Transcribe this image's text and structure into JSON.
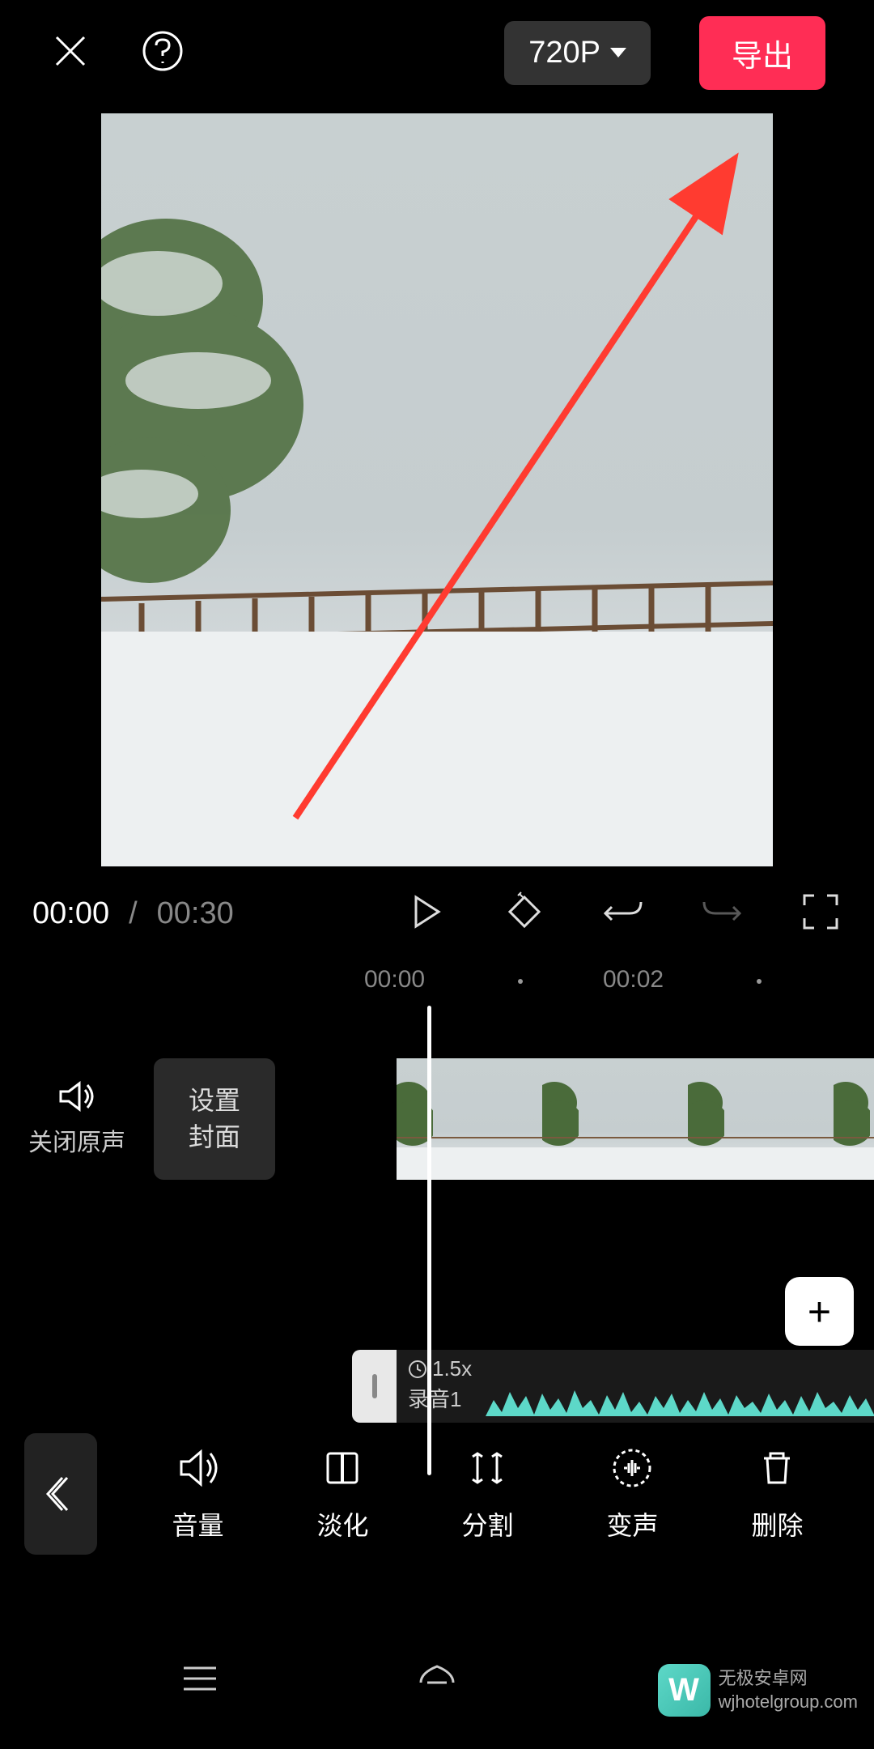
{
  "header": {
    "resolution": "720P",
    "export_label": "导出"
  },
  "playback": {
    "current_time": "00:00",
    "separator": "/",
    "total_time": "00:30"
  },
  "timeline": {
    "ruler_times": [
      "00:00",
      "00:02"
    ],
    "mute_label": "关闭原声",
    "cover_label_line1": "设置",
    "cover_label_line2": "封面",
    "add_label": "+",
    "audio_speed": "1.5x",
    "audio_name": "录音1"
  },
  "tools": [
    {
      "id": "volume",
      "label": "音量"
    },
    {
      "id": "fade",
      "label": "淡化"
    },
    {
      "id": "split",
      "label": "分割"
    },
    {
      "id": "voice",
      "label": "变声"
    },
    {
      "id": "delete",
      "label": "删除"
    }
  ],
  "watermark": {
    "logo": "W",
    "title": "无极安卓网",
    "url": "wjhotelgroup.com"
  }
}
